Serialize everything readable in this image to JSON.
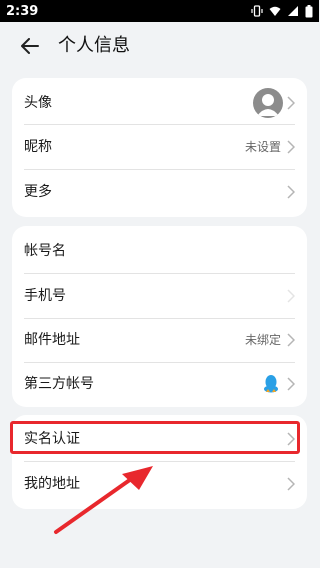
{
  "status_bar": {
    "time": "2:39"
  },
  "header": {
    "title": "个人信息"
  },
  "card1": {
    "rows": [
      {
        "label": "头像",
        "value": ""
      },
      {
        "label": "昵称",
        "value": "未设置"
      },
      {
        "label": "更多",
        "value": ""
      }
    ]
  },
  "card2": {
    "rows": [
      {
        "label": "帐号名",
        "value": ""
      },
      {
        "label": "手机号",
        "value": ""
      },
      {
        "label": "邮件地址",
        "value": "未绑定"
      },
      {
        "label": "第三方帐号",
        "value": ""
      }
    ]
  },
  "card3": {
    "rows": [
      {
        "label": "实名认证",
        "value": ""
      },
      {
        "label": "我的地址",
        "value": ""
      }
    ]
  },
  "colors": {
    "annotation": "#e8282d",
    "qq": "#2aa0e6"
  }
}
